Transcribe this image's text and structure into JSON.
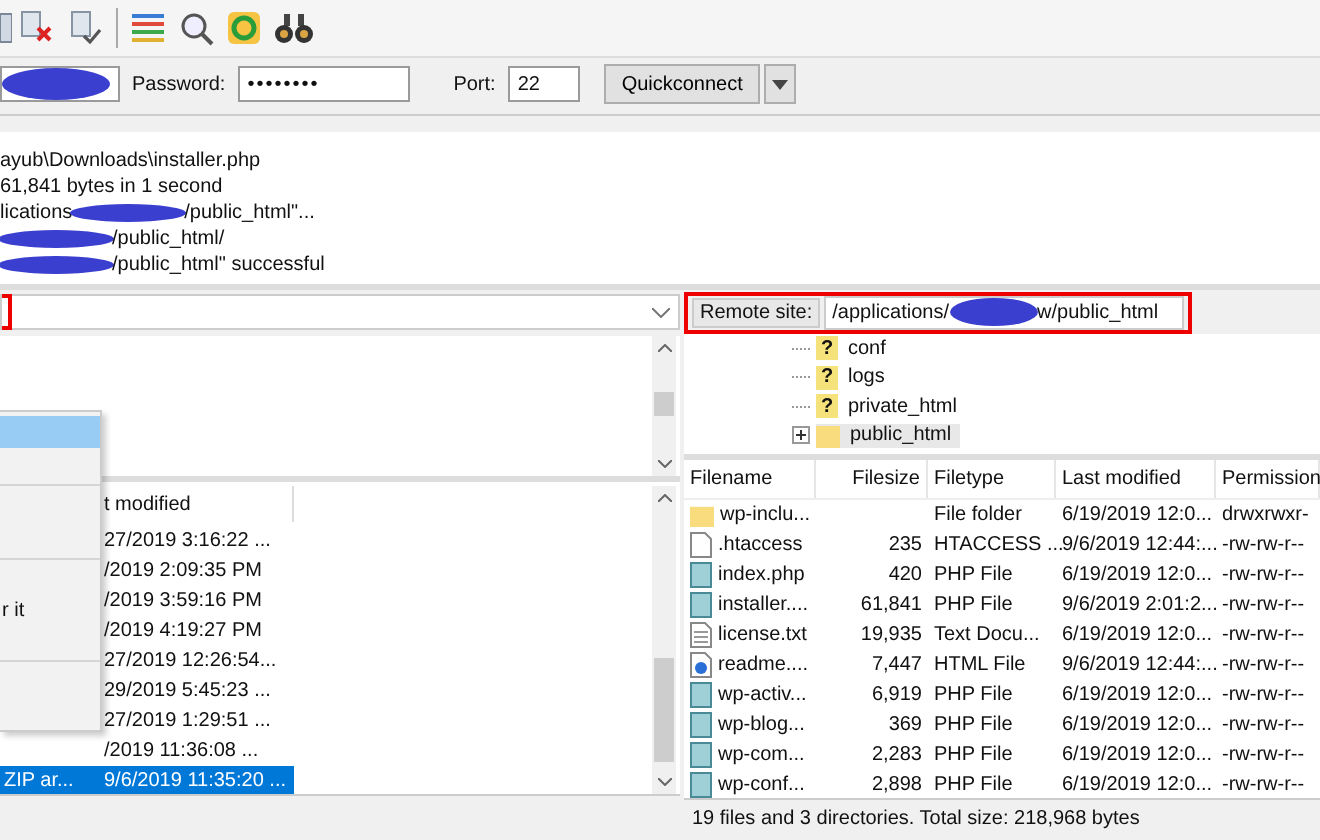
{
  "toolbar": {
    "buttons": [
      {
        "kind": "partial"
      },
      {
        "kind": "cancel"
      },
      {
        "kind": "disconnect"
      },
      {
        "kind": "separator"
      },
      {
        "kind": "filter"
      },
      {
        "kind": "search"
      },
      {
        "kind": "sync"
      },
      {
        "kind": "find"
      }
    ]
  },
  "quickconnect": {
    "host": {
      "redacted": true
    },
    "password_label": "Password:",
    "password_value": "••••••••",
    "port_label": "Port:",
    "port_value": "22",
    "button": "Quickconnect"
  },
  "log": [
    {
      "before": "ayub\\Downloads\\installer.php",
      "redacted": false
    },
    {
      "before": "61,841 bytes in 1 second",
      "redacted": false
    },
    {
      "before": "lications",
      "redacted": true,
      "after": "/public_html\"..."
    },
    {
      "redacted": true,
      "after": "/public_html/"
    },
    {
      "redacted": true,
      "after": "/public_html\" successful"
    }
  ],
  "local": {
    "file_list": {
      "columns": [
        "t modified"
      ],
      "rows": [
        {
          "modified": "27/2019 3:16:22 ...",
          "selected": false
        },
        {
          "modified": "/2019 2:09:35 PM",
          "selected": false
        },
        {
          "modified": "/2019 3:59:16 PM",
          "selected": false
        },
        {
          "modified": "/2019 4:19:27 PM",
          "selected": false
        },
        {
          "modified": "27/2019 12:26:54...",
          "selected": false
        },
        {
          "modified": "29/2019 5:45:23 ...",
          "selected": false
        },
        {
          "modified": "27/2019 1:29:51 ...",
          "selected": false
        },
        {
          "modified": "/2019 11:36:08 ...",
          "selected": false
        },
        {
          "type": "ZIP ar...",
          "modified": "9/6/2019 11:35:20 ...",
          "selected": true
        }
      ]
    },
    "context_menu": [
      {
        "kind": "item",
        "selected": true
      },
      {
        "kind": "blank"
      },
      {
        "kind": "separator"
      },
      {
        "kind": "blank"
      },
      {
        "kind": "blank"
      },
      {
        "kind": "separator"
      },
      {
        "kind": "blank"
      },
      {
        "kind": "item",
        "label": "r it",
        "selected": false
      },
      {
        "kind": "blank"
      },
      {
        "kind": "separator"
      },
      {
        "kind": "blank"
      },
      {
        "kind": "blank"
      }
    ]
  },
  "remote": {
    "site_label": "Remote site:",
    "path_before": "/applications/",
    "path_redacted": true,
    "path_after": "w/public_html",
    "tree": [
      {
        "name": "conf",
        "kind": "unknown",
        "icon_text": "?",
        "selected": false
      },
      {
        "name": "logs",
        "kind": "unknown",
        "icon_text": "?",
        "selected": false
      },
      {
        "name": "private_html",
        "kind": "unknown",
        "icon_text": "?",
        "selected": false
      },
      {
        "name": "public_html",
        "kind": "folder",
        "selected": true
      }
    ],
    "file_list": {
      "columns": [
        "Filename",
        "Filesize",
        "Filetype",
        "Last modified",
        "Permission"
      ],
      "rows": [
        {
          "kind": "folder",
          "name": "wp-inclu...",
          "type": "File folder",
          "modified": "6/19/2019 12:0...",
          "perm": "drwxrwxr-"
        },
        {
          "kind": "file",
          "name": ".htaccess",
          "size": "235",
          "type": "HTACCESS ...",
          "modified": "9/6/2019 12:44:...",
          "perm": "-rw-rw-r--"
        },
        {
          "kind": "php",
          "name": "index.php",
          "size": "420",
          "type": "PHP File",
          "modified": "6/19/2019 12:0...",
          "perm": "-rw-rw-r--"
        },
        {
          "kind": "php",
          "name": "installer....",
          "size": "61,841",
          "type": "PHP File",
          "modified": "9/6/2019 2:01:2...",
          "perm": "-rw-rw-r--"
        },
        {
          "kind": "text",
          "name": "license.txt",
          "size": "19,935",
          "type": "Text Docu...",
          "modified": "6/19/2019 12:0...",
          "perm": "-rw-rw-r--"
        },
        {
          "kind": "html",
          "name": "readme....",
          "size": "7,447",
          "type": "HTML File",
          "modified": "9/6/2019 12:44:...",
          "perm": "-rw-rw-r--"
        },
        {
          "kind": "php",
          "name": "wp-activ...",
          "size": "6,919",
          "type": "PHP File",
          "modified": "6/19/2019 12:0...",
          "perm": "-rw-rw-r--"
        },
        {
          "kind": "php",
          "name": "wp-blog...",
          "size": "369",
          "type": "PHP File",
          "modified": "6/19/2019 12:0...",
          "perm": "-rw-rw-r--"
        },
        {
          "kind": "php",
          "name": "wp-com...",
          "size": "2,283",
          "type": "PHP File",
          "modified": "6/19/2019 12:0...",
          "perm": "-rw-rw-r--"
        },
        {
          "kind": "php",
          "name": "wp-conf...",
          "size": "2,898",
          "type": "PHP File",
          "modified": "6/19/2019 12:0...",
          "perm": "-rw-rw-r--"
        }
      ]
    },
    "status": "19 files and 3 directories. Total size: 218,968 bytes"
  }
}
